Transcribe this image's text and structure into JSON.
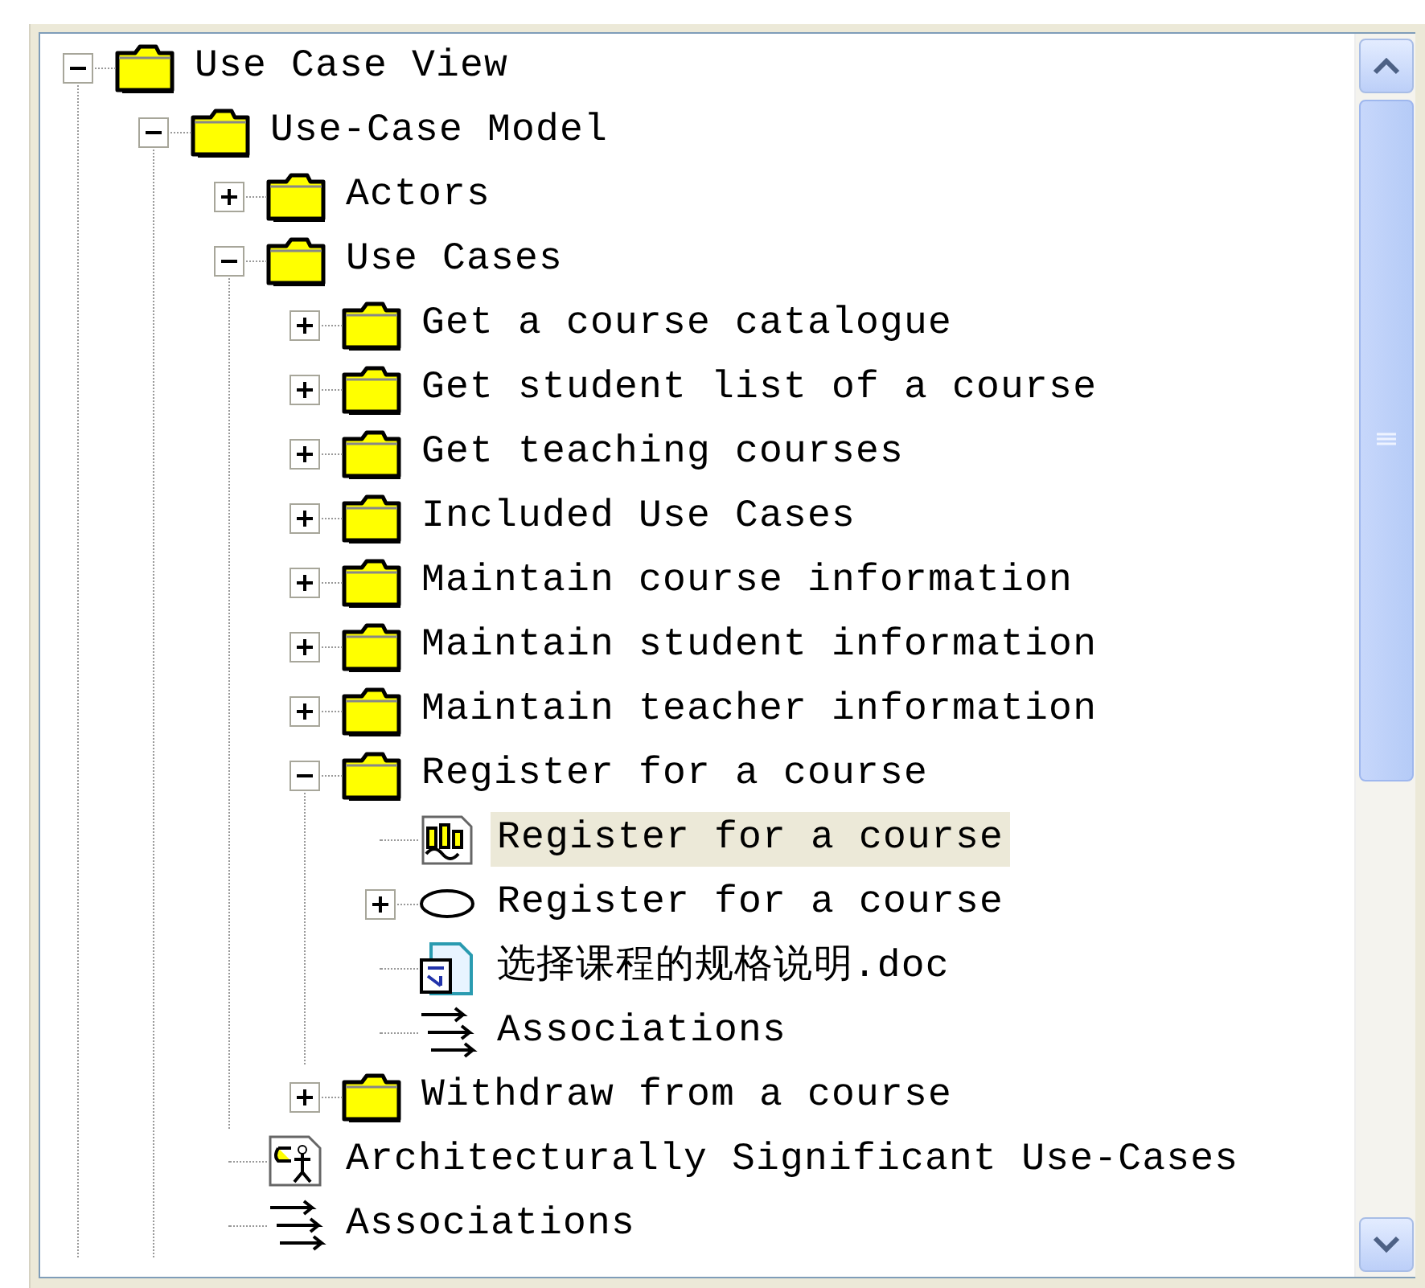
{
  "tree": {
    "nodes": [
      {
        "label": "Use Case View",
        "kind": "folder",
        "expanded": true,
        "selected": false,
        "children": [
          {
            "label": "Use-Case Model",
            "kind": "folder",
            "expanded": true,
            "selected": false,
            "children": [
              {
                "label": "Actors",
                "kind": "folder",
                "expanded": false,
                "selected": false
              },
              {
                "label": "Use Cases",
                "kind": "folder",
                "expanded": true,
                "selected": false,
                "children": [
                  {
                    "label": "Get a course catalogue",
                    "kind": "folder",
                    "expanded": false,
                    "selected": false
                  },
                  {
                    "label": "Get student list of a course",
                    "kind": "folder",
                    "expanded": false,
                    "selected": false
                  },
                  {
                    "label": "Get teaching courses",
                    "kind": "folder",
                    "expanded": false,
                    "selected": false
                  },
                  {
                    "label": "Included Use Cases",
                    "kind": "folder",
                    "expanded": false,
                    "selected": false
                  },
                  {
                    "label": "Maintain course information",
                    "kind": "folder",
                    "expanded": false,
                    "selected": false
                  },
                  {
                    "label": "Maintain student information",
                    "kind": "folder",
                    "expanded": false,
                    "selected": false
                  },
                  {
                    "label": "Maintain teacher information",
                    "kind": "folder",
                    "expanded": false,
                    "selected": false
                  },
                  {
                    "label": "Register for a course",
                    "kind": "folder",
                    "expanded": true,
                    "selected": false,
                    "children": [
                      {
                        "label": "Register for a course",
                        "kind": "diagram",
                        "selected": true
                      },
                      {
                        "label": "Register for a course",
                        "kind": "usecase",
                        "expanded": false,
                        "selected": false
                      },
                      {
                        "label": "选择课程的规格说明.doc",
                        "kind": "document",
                        "selected": false
                      },
                      {
                        "label": "Associations",
                        "kind": "associations",
                        "selected": false
                      }
                    ]
                  },
                  {
                    "label": "Withdraw from a course",
                    "kind": "folder",
                    "expanded": false,
                    "selected": false
                  }
                ]
              },
              {
                "label": "Architecturally Significant Use-Cases",
                "kind": "report",
                "selected": false
              },
              {
                "label": "Associations",
                "kind": "associations",
                "selected": false
              }
            ]
          }
        ]
      }
    ]
  }
}
